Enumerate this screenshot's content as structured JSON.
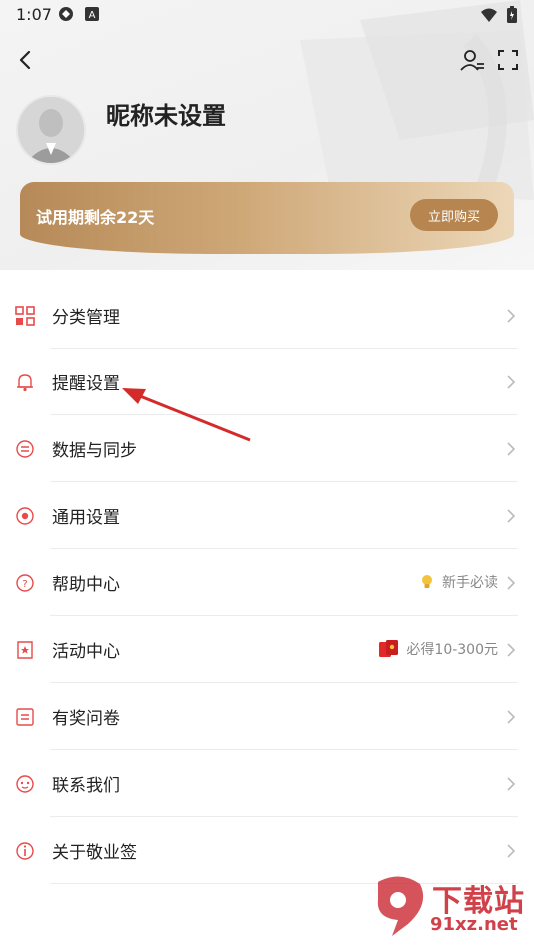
{
  "status_bar": {
    "time": "1:07",
    "left_icons": [
      "shield-icon",
      "a-badge-icon"
    ],
    "right_icons": [
      "wifi-icon",
      "battery-icon"
    ]
  },
  "topbar": {
    "back_icon": "chevron-left-icon",
    "right_icons": [
      "user-edit-icon",
      "fullscreen-icon"
    ]
  },
  "profile": {
    "nickname": "昵称未设置"
  },
  "trial_banner": {
    "text": "试用期剩余22天",
    "button_label": "立即购买"
  },
  "menu": {
    "items": [
      {
        "label": "分类管理",
        "icon": "category-icon",
        "extra": ""
      },
      {
        "label": "提醒设置",
        "icon": "bell-icon",
        "extra": ""
      },
      {
        "label": "数据与同步",
        "icon": "sync-icon",
        "extra": ""
      },
      {
        "label": "通用设置",
        "icon": "settings-icon",
        "extra": ""
      },
      {
        "label": "帮助中心",
        "icon": "help-icon",
        "extra": "新手必读",
        "extra_icon": "lightbulb-icon"
      },
      {
        "label": "活动中心",
        "icon": "event-icon",
        "extra": "必得10-300元",
        "extra_icon": "red-envelope-icon"
      },
      {
        "label": "有奖问卷",
        "icon": "survey-icon",
        "extra": ""
      },
      {
        "label": "联系我们",
        "icon": "contact-icon",
        "extra": ""
      },
      {
        "label": "关于敬业签",
        "icon": "info-icon",
        "extra": ""
      }
    ]
  },
  "watermark": {
    "title": "下载站",
    "url": "91xz.net"
  },
  "colors": {
    "accent_red": "#e84a4a",
    "banner_gold": "#b68a58"
  }
}
